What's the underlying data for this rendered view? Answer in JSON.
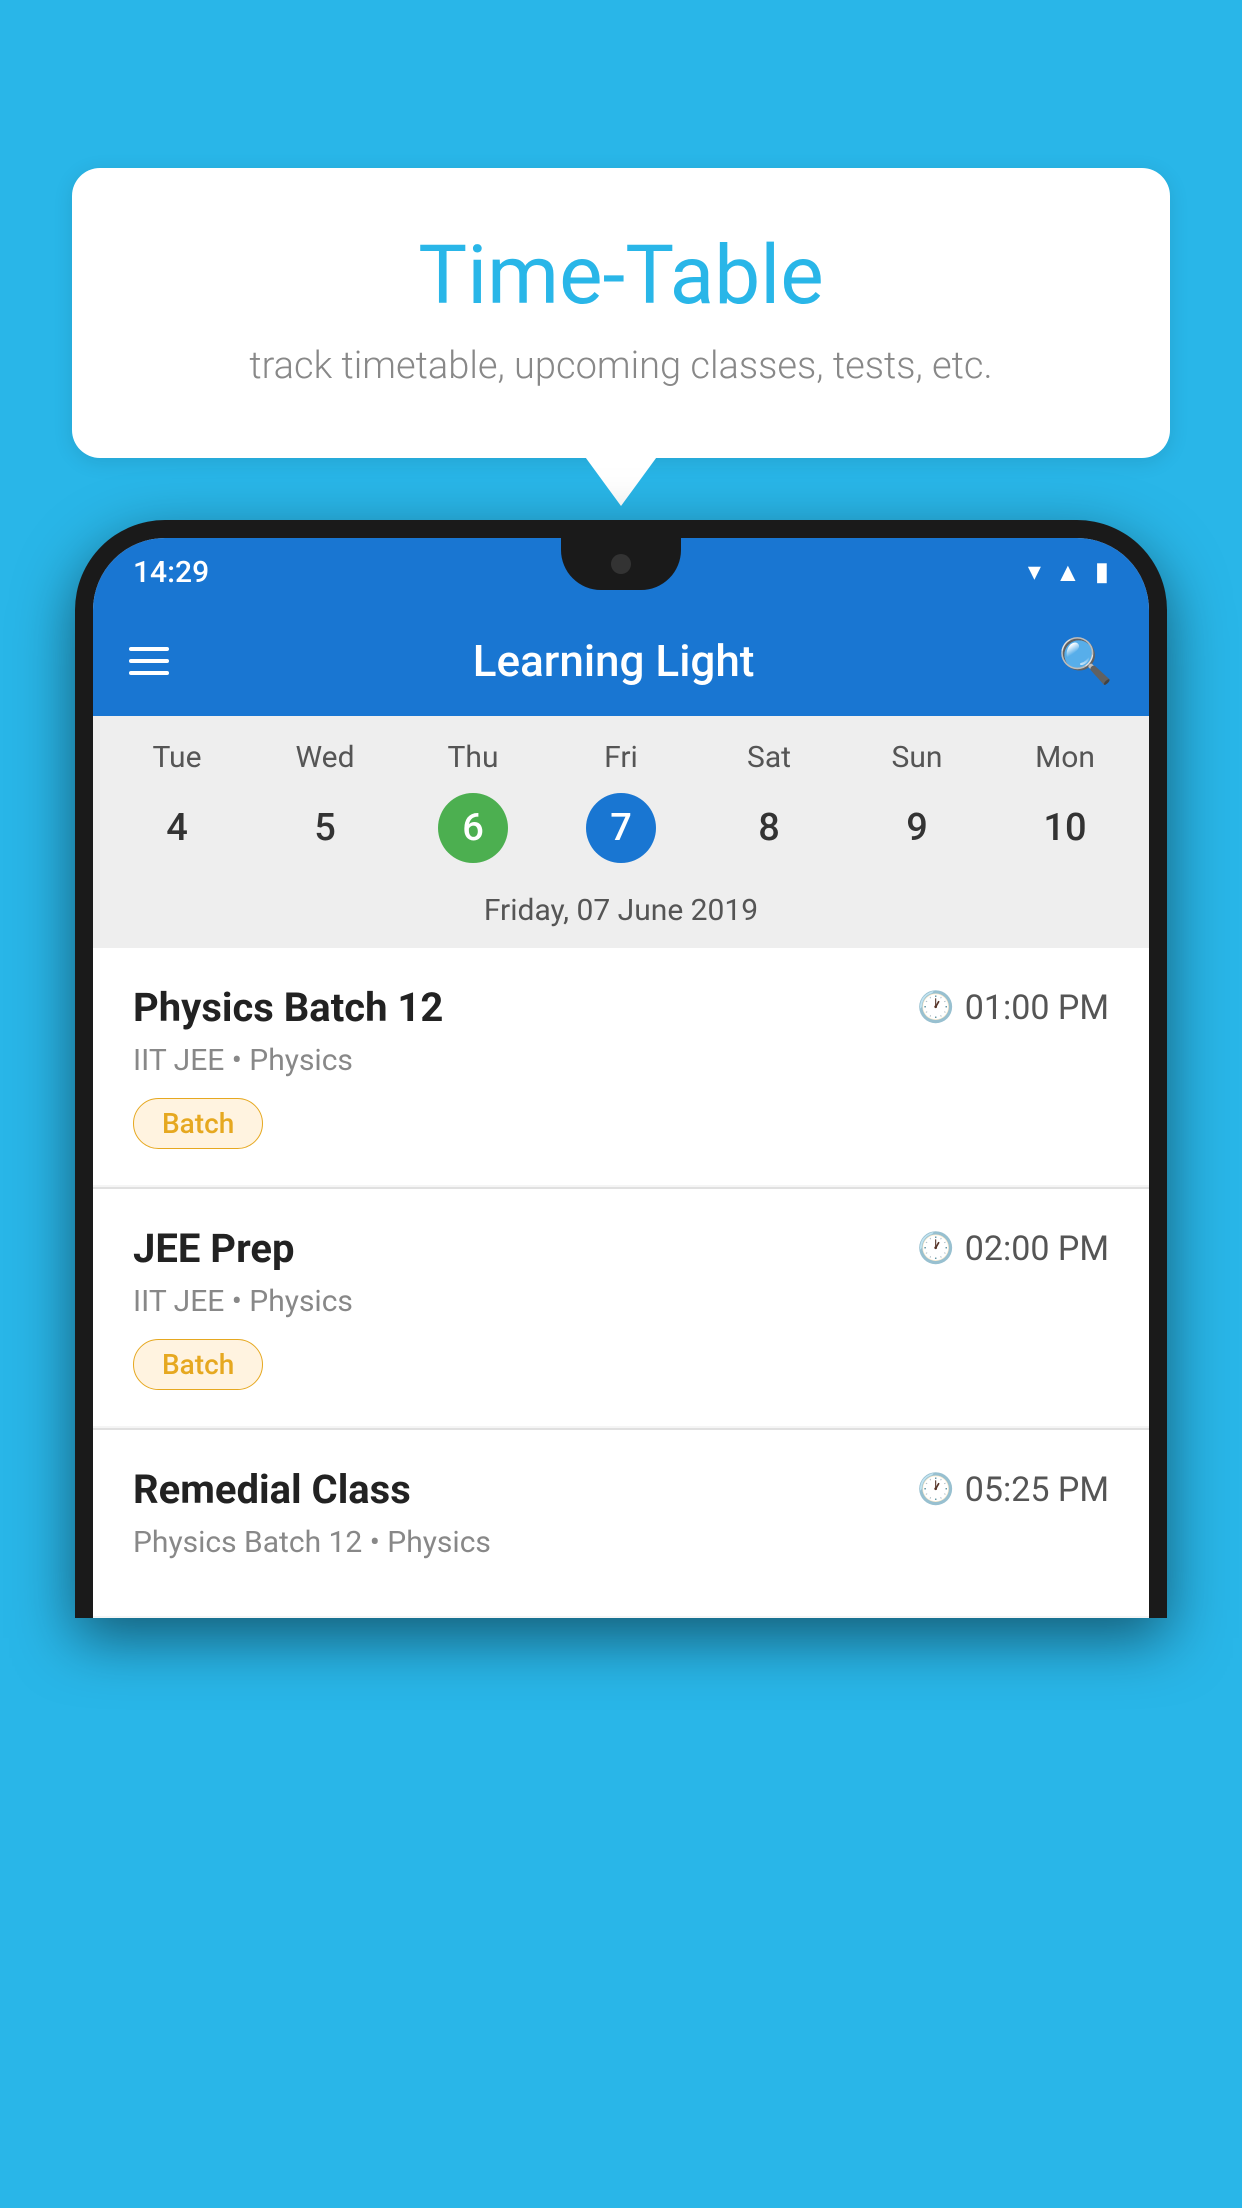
{
  "background_color": "#29b6e8",
  "tooltip": {
    "title": "Time-Table",
    "subtitle": "track timetable, upcoming classes, tests, etc."
  },
  "app": {
    "title": "Learning Light",
    "status_time": "14:29"
  },
  "calendar": {
    "days": [
      {
        "label": "Tue",
        "num": "4"
      },
      {
        "label": "Wed",
        "num": "5"
      },
      {
        "label": "Thu",
        "num": "6",
        "state": "today"
      },
      {
        "label": "Fri",
        "num": "7",
        "state": "selected"
      },
      {
        "label": "Sat",
        "num": "8"
      },
      {
        "label": "Sun",
        "num": "9"
      },
      {
        "label": "Mon",
        "num": "10"
      }
    ],
    "selected_date_label": "Friday, 07 June 2019"
  },
  "schedule": [
    {
      "title": "Physics Batch 12",
      "time": "01:00 PM",
      "meta": "IIT JEE • Physics",
      "tag": "Batch"
    },
    {
      "title": "JEE Prep",
      "time": "02:00 PM",
      "meta": "IIT JEE • Physics",
      "tag": "Batch"
    },
    {
      "title": "Remedial Class",
      "time": "05:25 PM",
      "meta": "Physics Batch 12 • Physics",
      "tag": ""
    }
  ]
}
